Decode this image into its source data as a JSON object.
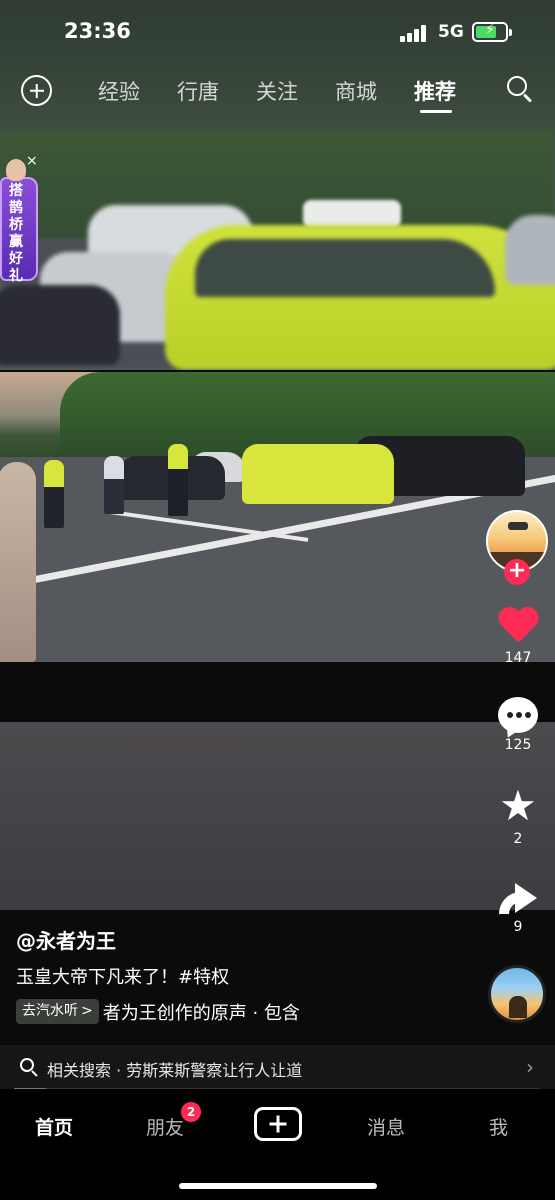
{
  "status_bar": {
    "time": "23:36",
    "network": "5G",
    "battery_level": 0.7
  },
  "top_nav": {
    "tabs": [
      {
        "label": "经验"
      },
      {
        "label": "行唐"
      },
      {
        "label": "关注"
      },
      {
        "label": "商城"
      },
      {
        "label": "推荐",
        "active": true
      }
    ]
  },
  "promo": {
    "text": "搭鹊桥赢好礼"
  },
  "rail": {
    "like_count": "147",
    "comment_count": "125",
    "favorite_count": "2",
    "share_count": "9"
  },
  "caption": {
    "author": "@永者为王",
    "description": "玉皇大帝下凡来了！#特权",
    "music_tag": "去汽水听",
    "music_tag_arrow": ">",
    "music_title": "者为王创作的原声 · 包含"
  },
  "related_search": {
    "label": "相关搜索 · 劳斯莱斯警察让行人让道",
    "chevron": "›",
    "progress": 0.06
  },
  "bottom_tabs": {
    "home": "首页",
    "friends": "朋友",
    "friends_badge": "2",
    "messages": "消息",
    "me": "我"
  },
  "colors": {
    "accent": "#fe2c55",
    "battery_fill": "#4cd964"
  }
}
